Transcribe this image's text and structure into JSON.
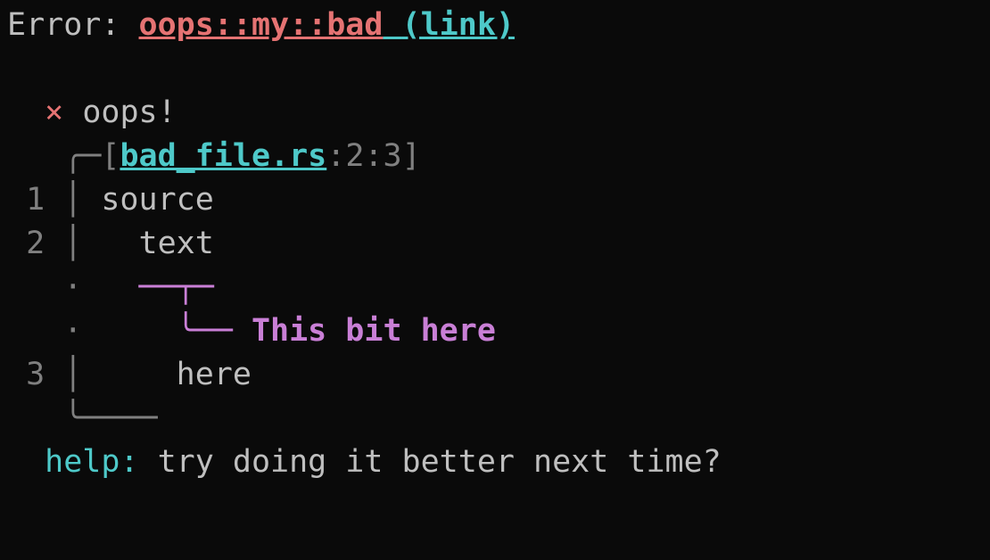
{
  "error": {
    "prefix": "Error: ",
    "code": "oops::my::bad",
    "space": " ",
    "link_label": "(link)"
  },
  "msg": {
    "indent": "  ",
    "cross": "×",
    "space": " ",
    "text": "oops!"
  },
  "file": {
    "indent": "   ",
    "corner": "╭─",
    "lbracket": "[",
    "name": "bad_file.rs",
    "colon": ":",
    "line": "2",
    "col": "3",
    "rbracket": "]"
  },
  "src": {
    "l1": {
      "gutter": " 1 │ ",
      "text": "source"
    },
    "l2": {
      "gutter": " 2 │ ",
      "indent": "  ",
      "text": "text"
    },
    "hl1": {
      "gutter": "   · ",
      "indent": "  ",
      "bar": "──┬─"
    },
    "hl2": {
      "gutter": "   · ",
      "indent": "    ",
      "arrow": "╰── ",
      "label": "This bit here"
    },
    "l3": {
      "gutter": " 3 │ ",
      "indent": "    ",
      "text": "here"
    },
    "end": {
      "indent": "   ",
      "corner": "╰────"
    }
  },
  "help": {
    "indent": "  ",
    "label": "help: ",
    "text": "try doing it better next time?"
  }
}
